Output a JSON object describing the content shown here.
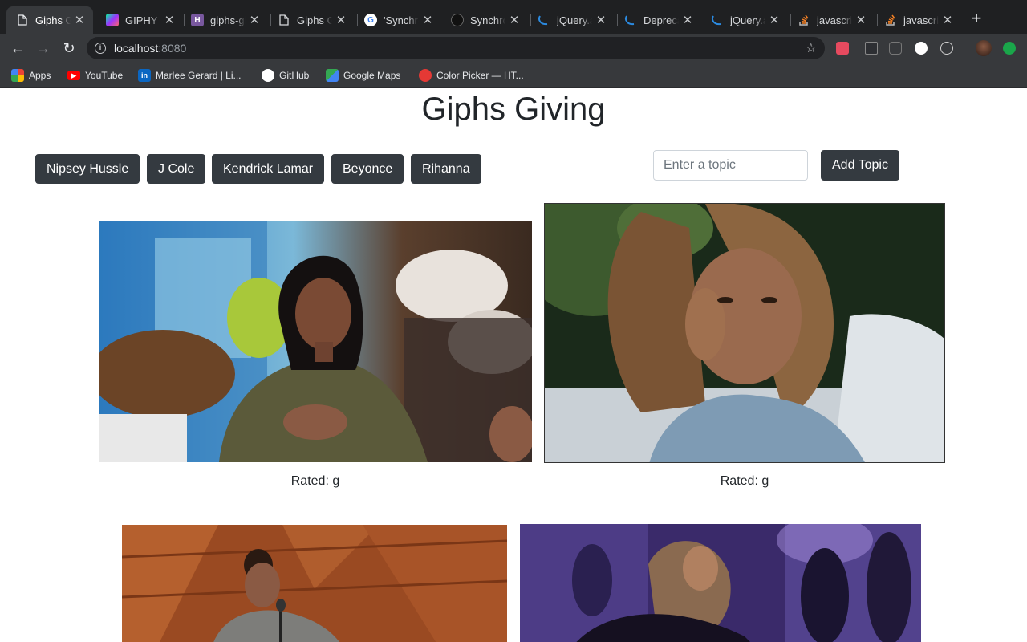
{
  "browser": {
    "tabs": [
      {
        "title": "Giphs Giving",
        "favicon": "page-icon",
        "active": true
      },
      {
        "title": "GIPHY Developers",
        "favicon": "giphy-icon",
        "active": false
      },
      {
        "title": "giphs-giving",
        "favicon": "heroku-icon",
        "active": false
      },
      {
        "title": "Giphs Giving",
        "favicon": "page-icon",
        "active": false
      },
      {
        "title": "'Synchronous'",
        "favicon": "google-icon",
        "active": false
      },
      {
        "title": "Synchronous",
        "favicon": "github-icon",
        "active": false
      },
      {
        "title": "jQuery.ajax()",
        "favicon": "jquery-icon",
        "active": false
      },
      {
        "title": "Deprecated",
        "favicon": "jquery-icon",
        "active": false
      },
      {
        "title": "jQuery.ajax()",
        "favicon": "jquery-icon",
        "active": false
      },
      {
        "title": "javascript",
        "favicon": "stackoverflow-icon",
        "active": false
      },
      {
        "title": "javascript",
        "favicon": "stackoverflow-icon",
        "active": false
      }
    ],
    "new_tab_label": "+",
    "address": {
      "host": "localhost",
      "port": ":8080"
    },
    "bookmarks": [
      {
        "label": "Apps",
        "icon": "apps-grid-icon",
        "color": "#4285f4"
      },
      {
        "label": "YouTube",
        "icon": "youtube-icon",
        "color": "#ff0000"
      },
      {
        "label": "Marlee Gerard | Li...",
        "icon": "linkedin-icon",
        "color": "#0a66c2"
      },
      {
        "label": "GitHub",
        "icon": "github-icon",
        "color": "#ffffff"
      },
      {
        "label": "Google Maps",
        "icon": "maps-icon",
        "color": "#34a853"
      },
      {
        "label": "Color Picker — HT...",
        "icon": "color-picker-icon",
        "color": "#e53935"
      }
    ]
  },
  "page": {
    "title": "Giphs Giving",
    "topics": [
      "Nipsey Hussle",
      "J Cole",
      "Kendrick Lamar",
      "Beyonce",
      "Rihanna"
    ],
    "input_placeholder": "Enter a topic",
    "add_button_label": "Add Topic",
    "gifs": [
      {
        "rating": "Rated: g"
      },
      {
        "rating": "Rated: g"
      },
      {
        "rating": ""
      },
      {
        "rating": ""
      }
    ]
  },
  "colors": {
    "button_dark": "#343a40",
    "text": "#212529",
    "chrome_dark": "#37393c",
    "tabstrip": "#1f2022"
  }
}
